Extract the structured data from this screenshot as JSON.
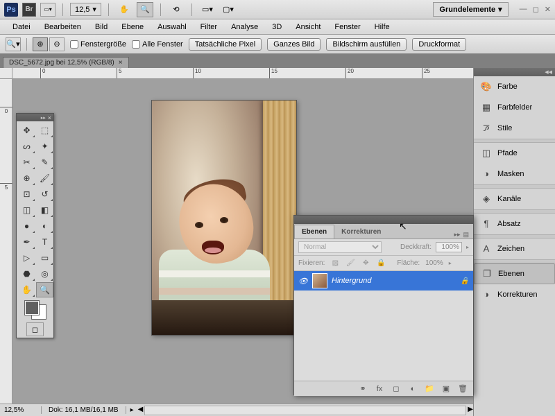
{
  "titlebar": {
    "zoom": "12,5",
    "workspace": "Grundelemente"
  },
  "menu": {
    "datei": "Datei",
    "bearbeiten": "Bearbeiten",
    "bild": "Bild",
    "ebene": "Ebene",
    "auswahl": "Auswahl",
    "filter": "Filter",
    "analyse": "Analyse",
    "3d": "3D",
    "ansicht": "Ansicht",
    "fenster": "Fenster",
    "hilfe": "Hilfe"
  },
  "options": {
    "fenstergroesse": "Fenstergröße",
    "alle_fenster": "Alle Fenster",
    "tatsaechliche_pixel": "Tatsächliche Pixel",
    "ganzes_bild": "Ganzes Bild",
    "bildschirm_ausfuellen": "Bildschirm ausfüllen",
    "druckformat": "Druckformat"
  },
  "doc": {
    "tab": "DSC_5672.jpg bei 12,5% (RGB/8)"
  },
  "ruler": {
    "h": [
      "0",
      "5",
      "10",
      "15",
      "20",
      "25"
    ],
    "v": [
      "0",
      "5"
    ]
  },
  "panels": {
    "farbe": "Farbe",
    "farbfelder": "Farbfelder",
    "stile": "Stile",
    "pfade": "Pfade",
    "masken": "Masken",
    "kanaele": "Kanäle",
    "absatz": "Absatz",
    "zeichen": "Zeichen",
    "ebenen": "Ebenen",
    "korrekturen": "Korrekturen"
  },
  "layers": {
    "tab_ebenen": "Ebenen",
    "tab_korrekturen": "Korrekturen",
    "blend_mode": "Normal",
    "deckkraft_label": "Deckkraft:",
    "deckkraft_value": "100%",
    "fixieren_label": "Fixieren:",
    "flaeche_label": "Fläche:",
    "flaeche_value": "100%",
    "layer_name": "Hintergrund"
  },
  "status": {
    "zoom": "12,5%",
    "doc": "Dok: 16,1 MB/16,1 MB"
  }
}
